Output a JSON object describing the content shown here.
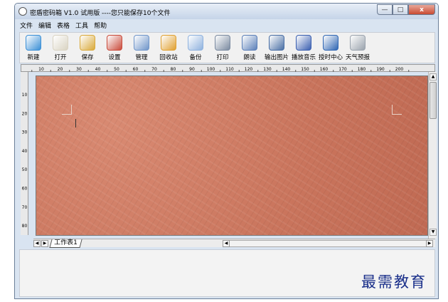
{
  "window": {
    "title": "密盾密码箱 V1.0 试用版 ----您只能保存10个文件",
    "controls": {
      "minimize": "—",
      "maximize": "□",
      "close": "x"
    }
  },
  "menu": [
    "文件",
    "编辑",
    "表格",
    "工具",
    "帮助"
  ],
  "toolbar": [
    {
      "label": "新建",
      "icon": "new-icon",
      "color": "#3a8fd6"
    },
    {
      "label": "打开",
      "icon": "open-book-icon",
      "color": "#d9d3c2"
    },
    {
      "label": "保存",
      "icon": "save-icon",
      "color": "#d9a93a"
    },
    {
      "label": "设置",
      "icon": "settings-pin-icon",
      "color": "#c94b3b"
    },
    {
      "label": "管理",
      "icon": "manage-icon",
      "color": "#6f95c9"
    },
    {
      "label": "回收站",
      "icon": "recycle-bin-icon",
      "color": "#e0a030"
    },
    {
      "label": "备份",
      "icon": "backup-icon",
      "color": "#8fb2de"
    },
    {
      "label": "打印",
      "icon": "printer-icon",
      "color": "#7a8aa0"
    },
    {
      "label": "朗读",
      "icon": "read-aloud-icon",
      "color": "#5b7fb8"
    },
    {
      "label": "输出图片",
      "icon": "export-image-icon",
      "color": "#4a6fa5"
    },
    {
      "label": "播放音乐",
      "icon": "music-icon",
      "color": "#3a5fb0"
    },
    {
      "label": "授时中心",
      "icon": "magnifier-icon",
      "color": "#2f66b3"
    },
    {
      "label": "天气预报",
      "icon": "weather-icon",
      "color": "#9aa3ad"
    }
  ],
  "ruler": {
    "h_ticks": [
      "10",
      "20",
      "30",
      "40",
      "50",
      "60",
      "70",
      "80",
      "90",
      "100",
      "110",
      "120",
      "130",
      "140",
      "150",
      "160",
      "170",
      "180",
      "190",
      "200"
    ],
    "v_ticks": [
      "10",
      "20",
      "30",
      "40",
      "50",
      "60",
      "70",
      "80"
    ]
  },
  "sheet_tab": "工作表1",
  "watermark": "最需教育",
  "colors": {
    "canvas": "#c9745c",
    "watermark": "#1a2f8a"
  }
}
